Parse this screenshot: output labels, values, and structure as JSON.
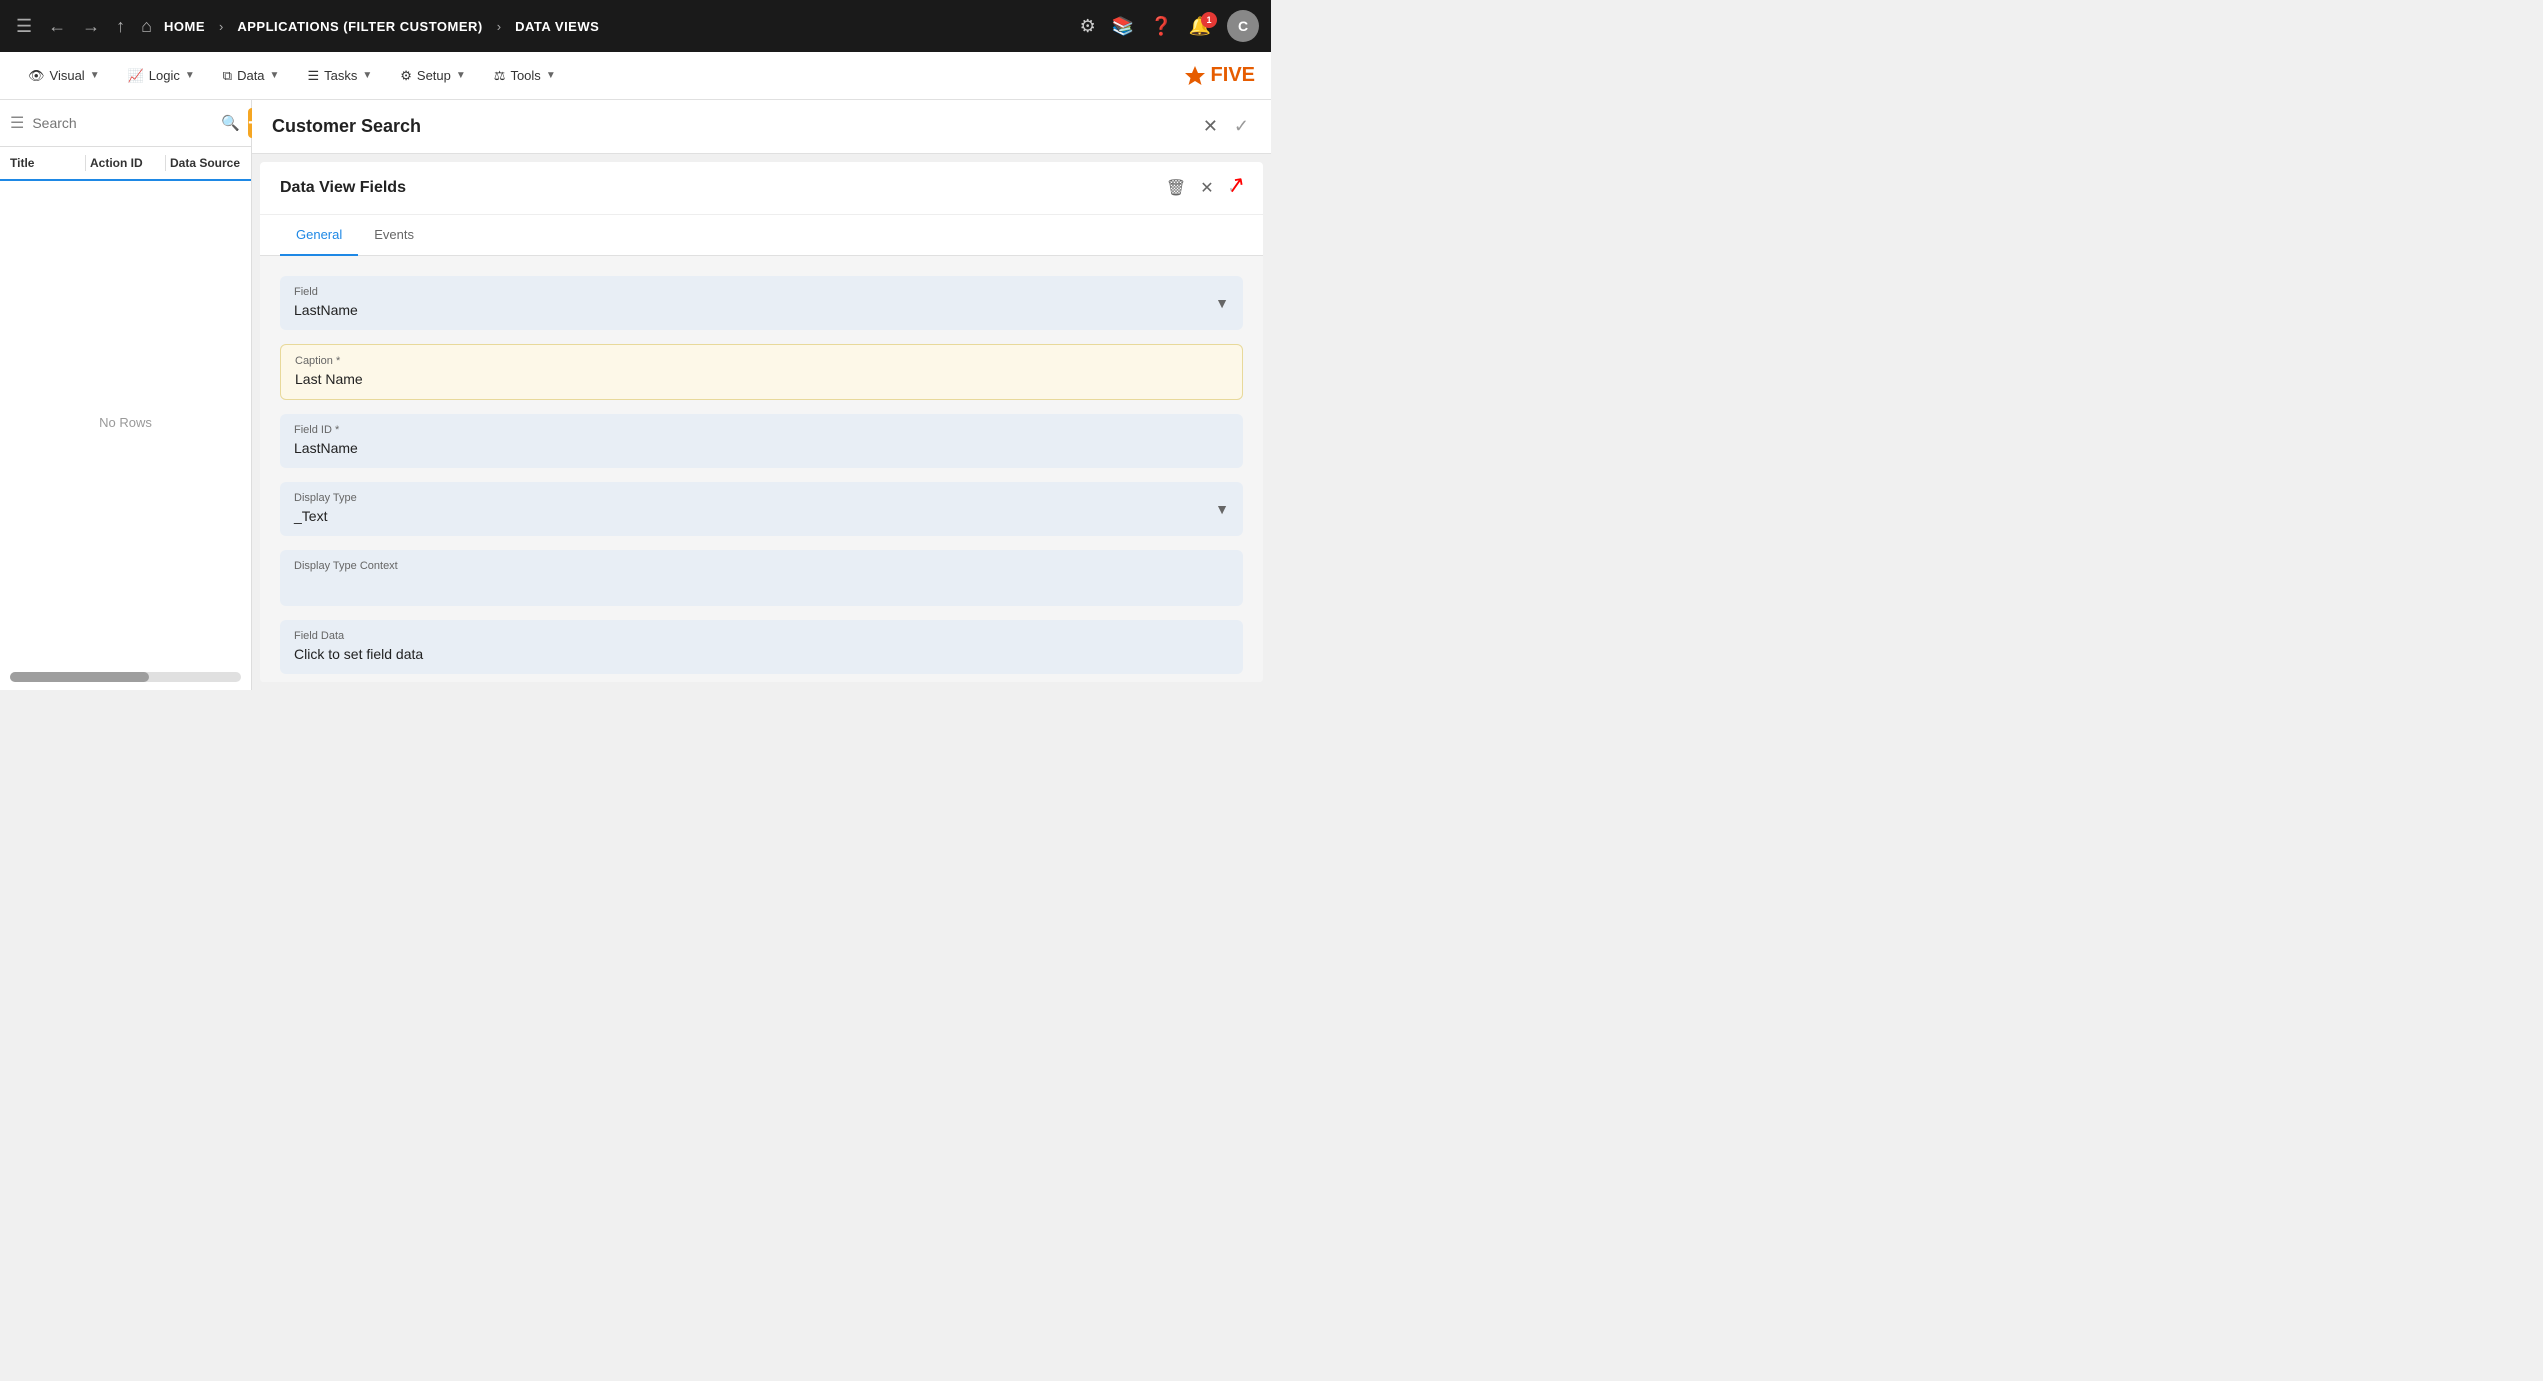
{
  "topNav": {
    "breadcrumbs": [
      "HOME",
      "APPLICATIONS (FILTER CUSTOMER)",
      "DATA VIEWS"
    ],
    "avatarLabel": "C",
    "notificationCount": "1"
  },
  "secondNav": {
    "items": [
      {
        "label": "Visual",
        "icon": "eye"
      },
      {
        "label": "Logic",
        "icon": "logic"
      },
      {
        "label": "Data",
        "icon": "table"
      },
      {
        "label": "Tasks",
        "icon": "tasks"
      },
      {
        "label": "Setup",
        "icon": "gear"
      },
      {
        "label": "Tools",
        "icon": "tools"
      }
    ],
    "logoText": "FIVE"
  },
  "leftPanel": {
    "searchPlaceholder": "Search",
    "tableHeaders": {
      "title": "Title",
      "actionId": "Action ID",
      "dataSource": "Data Source"
    },
    "emptyMessage": "No Rows"
  },
  "customerSearch": {
    "title": "Customer Search",
    "section": {
      "title": "Data View Fields",
      "tabs": [
        "General",
        "Events"
      ],
      "activeTab": "General",
      "form": {
        "fieldLabel": "Field",
        "fieldValue": "LastName",
        "captionLabel": "Caption *",
        "captionValue": "Last Name",
        "fieldIdLabel": "Field ID *",
        "fieldIdValue": "LastName",
        "displayTypeLabel": "Display Type",
        "displayTypeValue": "_Text",
        "displayTypeContextLabel": "Display Type Context",
        "displayTypeContextValue": "",
        "fieldDataLabel": "Field Data",
        "fieldDataValue": "Click to set field data"
      }
    }
  }
}
